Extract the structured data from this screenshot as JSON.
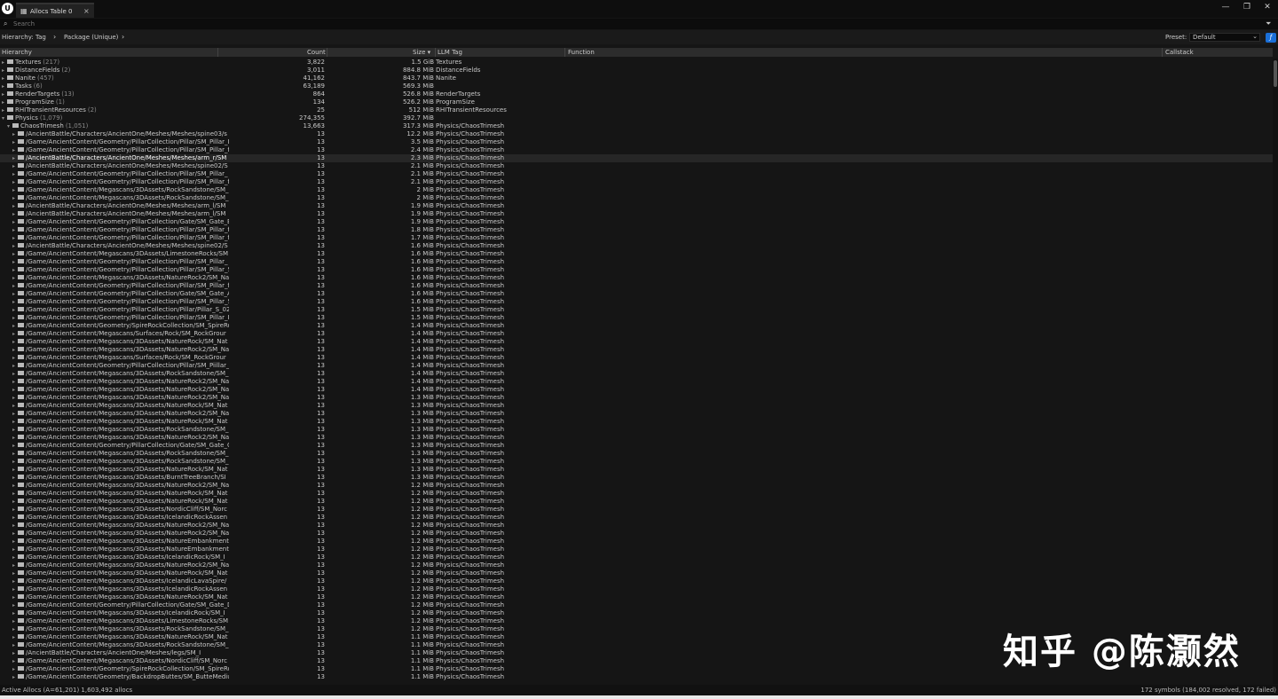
{
  "window": {
    "tab_label": "Allocs Table 0",
    "tab_close": "×",
    "minimize": "—",
    "restore": "❐",
    "close": "✕",
    "logo": "U"
  },
  "search": {
    "placeholder": "Search"
  },
  "hierarchy_bar": {
    "label": "Hierarchy:",
    "items": [
      "Tag",
      "Package (Unique)"
    ],
    "preset_label": "Preset:",
    "preset_value": "Default",
    "function_button": "ƒ"
  },
  "columns": {
    "hierarchy": "Hierarchy",
    "count": "Count",
    "size": "Size ▾",
    "llm_tag": "LLM Tag",
    "function": "Function",
    "callstack": "Callstack"
  },
  "icons": {
    "search": "search-icon",
    "filter": "filter-icon",
    "folder": "folder-icon",
    "expand": "expand-arrow-icon"
  },
  "rows": [
    {
      "level": 0,
      "open": false,
      "name": "Textures",
      "cnt": "(217)",
      "count": "3,822",
      "size": "1.5 GiB",
      "tag": "Textures"
    },
    {
      "level": 0,
      "open": false,
      "name": "DistanceFields",
      "cnt": "(2)",
      "count": "3,011",
      "size": "884.8 MiB",
      "tag": "DistanceFields"
    },
    {
      "level": 0,
      "open": false,
      "name": "Nanite",
      "cnt": "(457)",
      "count": "41,162",
      "size": "843.7 MiB",
      "tag": "Nanite"
    },
    {
      "level": 0,
      "open": false,
      "name": "Tasks",
      "cnt": "(6)",
      "count": "63,189",
      "size": "569.3 MiB",
      "tag": ""
    },
    {
      "level": 0,
      "open": false,
      "name": "RenderTargets",
      "cnt": "(13)",
      "count": "864",
      "size": "526.8 MiB",
      "tag": "RenderTargets"
    },
    {
      "level": 0,
      "open": false,
      "name": "ProgramSize",
      "cnt": "(1)",
      "count": "134",
      "size": "526.2 MiB",
      "tag": "ProgramSize"
    },
    {
      "level": 0,
      "open": false,
      "name": "RHITransientResources",
      "cnt": "(2)",
      "count": "25",
      "size": "512 MiB",
      "tag": "RHITransientResources"
    },
    {
      "level": 0,
      "open": true,
      "name": "Physics",
      "cnt": "(1,079)",
      "count": "274,355",
      "size": "392.7 MiB",
      "tag": ""
    },
    {
      "level": 1,
      "open": true,
      "name": "ChaosTrimesh",
      "cnt": "(1,051)",
      "count": "13,663",
      "size": "317.3 MiB",
      "tag": "Physics/ChaosTrimesh"
    },
    {
      "level": 2,
      "name": "/AncientBattle/Characters/AncientOne/Meshes/Meshes/spine03/s",
      "count": "13",
      "size": "12.2 MiB",
      "tag": "Physics/ChaosTrimesh"
    },
    {
      "level": 2,
      "name": "/Game/AncientContent/Geometry/PillarCollection/Pillar/SM_Pillar_I",
      "count": "13",
      "size": "3.5 MiB",
      "tag": "Physics/ChaosTrimesh"
    },
    {
      "level": 2,
      "name": "/Game/AncientContent/Geometry/PillarCollection/Pillar/SM_Pillar_f",
      "count": "13",
      "size": "2.4 MiB",
      "tag": "Physics/ChaosTrimesh"
    },
    {
      "level": 2,
      "name": "/AncientBattle/Characters/AncientOne/Meshes/Meshes/arm_r/SM",
      "count": "13",
      "size": "2.3 MiB",
      "tag": "Physics/ChaosTrimesh",
      "selected": true
    },
    {
      "level": 2,
      "name": "/AncientBattle/Characters/AncientOne/Meshes/Meshes/spine02/S",
      "count": "13",
      "size": "2.1 MiB",
      "tag": "Physics/ChaosTrimesh"
    },
    {
      "level": 2,
      "name": "/Game/AncientContent/Geometry/PillarCollection/Pillar/SM_Pillar_",
      "count": "13",
      "size": "2.1 MiB",
      "tag": "Physics/ChaosTrimesh"
    },
    {
      "level": 2,
      "name": "/Game/AncientContent/Geometry/PillarCollection/Pillar/SM_Pillar_f",
      "count": "13",
      "size": "2.1 MiB",
      "tag": "Physics/ChaosTrimesh"
    },
    {
      "level": 2,
      "name": "/Game/AncientContent/Megascans/3DAssets/RockSandstone/SM_",
      "count": "13",
      "size": "2 MiB",
      "tag": "Physics/ChaosTrimesh"
    },
    {
      "level": 2,
      "name": "/Game/AncientContent/Megascans/3DAssets/RockSandstone/SM_",
      "count": "13",
      "size": "2 MiB",
      "tag": "Physics/ChaosTrimesh"
    },
    {
      "level": 2,
      "name": "/AncientBattle/Characters/AncientOne/Meshes/Meshes/arm_l/SM",
      "count": "13",
      "size": "1.9 MiB",
      "tag": "Physics/ChaosTrimesh"
    },
    {
      "level": 2,
      "name": "/AncientBattle/Characters/AncientOne/Meshes/Meshes/arm_l/SM",
      "count": "13",
      "size": "1.9 MiB",
      "tag": "Physics/ChaosTrimesh"
    },
    {
      "level": 2,
      "name": "/Game/AncientContent/Geometry/PillarCollection/Gate/SM_Gate_B",
      "count": "13",
      "size": "1.9 MiB",
      "tag": "Physics/ChaosTrimesh"
    },
    {
      "level": 2,
      "name": "/Game/AncientContent/Geometry/PillarCollection/Pillar/SM_Pillar_f",
      "count": "13",
      "size": "1.8 MiB",
      "tag": "Physics/ChaosTrimesh"
    },
    {
      "level": 2,
      "name": "/Game/AncientContent/Geometry/PillarCollection/Pillar/SM_Pillar_f",
      "count": "13",
      "size": "1.7 MiB",
      "tag": "Physics/ChaosTrimesh"
    },
    {
      "level": 2,
      "name": "/AncientBattle/Characters/AncientOne/Meshes/Meshes/spine02/S",
      "count": "13",
      "size": "1.6 MiB",
      "tag": "Physics/ChaosTrimesh"
    },
    {
      "level": 2,
      "name": "/Game/AncientContent/Megascans/3DAssets/LimestoneRocks/SM",
      "count": "13",
      "size": "1.6 MiB",
      "tag": "Physics/ChaosTrimesh"
    },
    {
      "level": 2,
      "name": "/Game/AncientContent/Geometry/PillarCollection/Pillar/SM_Pillar_",
      "count": "13",
      "size": "1.6 MiB",
      "tag": "Physics/ChaosTrimesh"
    },
    {
      "level": 2,
      "name": "/Game/AncientContent/Geometry/PillarCollection/Pillar/SM_Pillar_S",
      "count": "13",
      "size": "1.6 MiB",
      "tag": "Physics/ChaosTrimesh"
    },
    {
      "level": 2,
      "name": "/Game/AncientContent/Megascans/3DAssets/NatureRock2/SM_Na",
      "count": "13",
      "size": "1.6 MiB",
      "tag": "Physics/ChaosTrimesh"
    },
    {
      "level": 2,
      "name": "/Game/AncientContent/Geometry/PillarCollection/Pillar/SM_Pillar_f",
      "count": "13",
      "size": "1.6 MiB",
      "tag": "Physics/ChaosTrimesh"
    },
    {
      "level": 2,
      "name": "/Game/AncientContent/Geometry/PillarCollection/Gate/SM_Gate_A",
      "count": "13",
      "size": "1.6 MiB",
      "tag": "Physics/ChaosTrimesh"
    },
    {
      "level": 2,
      "name": "/Game/AncientContent/Geometry/PillarCollection/Pillar/SM_Pillar_S",
      "count": "13",
      "size": "1.6 MiB",
      "tag": "Physics/ChaosTrimesh"
    },
    {
      "level": 2,
      "name": "/Game/AncientContent/Geometry/PillarCollection/Pillar/Pillar_S_02",
      "count": "13",
      "size": "1.5 MiB",
      "tag": "Physics/ChaosTrimesh"
    },
    {
      "level": 2,
      "name": "/Game/AncientContent/Geometry/PillarCollection/Pillar/SM_Pillar_I",
      "count": "13",
      "size": "1.5 MiB",
      "tag": "Physics/ChaosTrimesh"
    },
    {
      "level": 2,
      "name": "/Game/AncientContent/Geometry/SpireRockCollection/SM_SpireRo",
      "count": "13",
      "size": "1.4 MiB",
      "tag": "Physics/ChaosTrimesh"
    },
    {
      "level": 2,
      "name": "/Game/AncientContent/Megascans/Surfaces/Rock/SM_RockGrour",
      "count": "13",
      "size": "1.4 MiB",
      "tag": "Physics/ChaosTrimesh"
    },
    {
      "level": 2,
      "name": "/Game/AncientContent/Megascans/3DAssets/NatureRock/SM_Nat",
      "count": "13",
      "size": "1.4 MiB",
      "tag": "Physics/ChaosTrimesh"
    },
    {
      "level": 2,
      "name": "/Game/AncientContent/Megascans/3DAssets/NatureRock2/SM_Na",
      "count": "13",
      "size": "1.4 MiB",
      "tag": "Physics/ChaosTrimesh"
    },
    {
      "level": 2,
      "name": "/Game/AncientContent/Megascans/Surfaces/Rock/SM_RockGrour",
      "count": "13",
      "size": "1.4 MiB",
      "tag": "Physics/ChaosTrimesh"
    },
    {
      "level": 2,
      "name": "/Game/AncientContent/Geometry/PillarCollection/Pillar/SM_Piillar_",
      "count": "13",
      "size": "1.4 MiB",
      "tag": "Physics/ChaosTrimesh"
    },
    {
      "level": 2,
      "name": "/Game/AncientContent/Megascans/3DAssets/RockSandstone/SM_",
      "count": "13",
      "size": "1.4 MiB",
      "tag": "Physics/ChaosTrimesh"
    },
    {
      "level": 2,
      "name": "/Game/AncientContent/Megascans/3DAssets/NatureRock2/SM_Na",
      "count": "13",
      "size": "1.4 MiB",
      "tag": "Physics/ChaosTrimesh"
    },
    {
      "level": 2,
      "name": "/Game/AncientContent/Megascans/3DAssets/NatureRock2/SM_Na",
      "count": "13",
      "size": "1.4 MiB",
      "tag": "Physics/ChaosTrimesh"
    },
    {
      "level": 2,
      "name": "/Game/AncientContent/Megascans/3DAssets/NatureRock2/SM_Na",
      "count": "13",
      "size": "1.3 MiB",
      "tag": "Physics/ChaosTrimesh"
    },
    {
      "level": 2,
      "name": "/Game/AncientContent/Megascans/3DAssets/NatureRock/SM_Nat",
      "count": "13",
      "size": "1.3 MiB",
      "tag": "Physics/ChaosTrimesh"
    },
    {
      "level": 2,
      "name": "/Game/AncientContent/Megascans/3DAssets/NatureRock2/SM_Na",
      "count": "13",
      "size": "1.3 MiB",
      "tag": "Physics/ChaosTrimesh"
    },
    {
      "level": 2,
      "name": "/Game/AncientContent/Megascans/3DAssets/NatureRock/SM_Nat",
      "count": "13",
      "size": "1.3 MiB",
      "tag": "Physics/ChaosTrimesh"
    },
    {
      "level": 2,
      "name": "/Game/AncientContent/Megascans/3DAssets/RockSandstone/SM_",
      "count": "13",
      "size": "1.3 MiB",
      "tag": "Physics/ChaosTrimesh"
    },
    {
      "level": 2,
      "name": "/Game/AncientContent/Megascans/3DAssets/NatureRock2/SM_Na",
      "count": "13",
      "size": "1.3 MiB",
      "tag": "Physics/ChaosTrimesh"
    },
    {
      "level": 2,
      "name": "/Game/AncientContent/Geometry/PillarCollection/Gate/SM_Gate_C",
      "count": "13",
      "size": "1.3 MiB",
      "tag": "Physics/ChaosTrimesh"
    },
    {
      "level": 2,
      "name": "/Game/AncientContent/Megascans/3DAssets/RockSandstone/SM_",
      "count": "13",
      "size": "1.3 MiB",
      "tag": "Physics/ChaosTrimesh"
    },
    {
      "level": 2,
      "name": "/Game/AncientContent/Megascans/3DAssets/RockSandstone/SM_",
      "count": "13",
      "size": "1.3 MiB",
      "tag": "Physics/ChaosTrimesh"
    },
    {
      "level": 2,
      "name": "/Game/AncientContent/Megascans/3DAssets/NatureRock/SM_Nat",
      "count": "13",
      "size": "1.3 MiB",
      "tag": "Physics/ChaosTrimesh"
    },
    {
      "level": 2,
      "name": "/Game/AncientContent/Megascans/3DAssets/BurntTreeBranch/SI",
      "count": "13",
      "size": "1.3 MiB",
      "tag": "Physics/ChaosTrimesh"
    },
    {
      "level": 2,
      "name": "/Game/AncientContent/Megascans/3DAssets/NatureRock2/SM_Na",
      "count": "13",
      "size": "1.2 MiB",
      "tag": "Physics/ChaosTrimesh"
    },
    {
      "level": 2,
      "name": "/Game/AncientContent/Megascans/3DAssets/NatureRock/SM_Nat",
      "count": "13",
      "size": "1.2 MiB",
      "tag": "Physics/ChaosTrimesh"
    },
    {
      "level": 2,
      "name": "/Game/AncientContent/Megascans/3DAssets/NatureRock/SM_Nat",
      "count": "13",
      "size": "1.2 MiB",
      "tag": "Physics/ChaosTrimesh"
    },
    {
      "level": 2,
      "name": "/Game/AncientContent/Megascans/3DAssets/NordicCliff/SM_Norc",
      "count": "13",
      "size": "1.2 MiB",
      "tag": "Physics/ChaosTrimesh"
    },
    {
      "level": 2,
      "name": "/Game/AncientContent/Megascans/3DAssets/IcelandicRockAssen",
      "count": "13",
      "size": "1.2 MiB",
      "tag": "Physics/ChaosTrimesh"
    },
    {
      "level": 2,
      "name": "/Game/AncientContent/Megascans/3DAssets/NatureRock2/SM_Na",
      "count": "13",
      "size": "1.2 MiB",
      "tag": "Physics/ChaosTrimesh"
    },
    {
      "level": 2,
      "name": "/Game/AncientContent/Megascans/3DAssets/NatureRock2/SM_Na",
      "count": "13",
      "size": "1.2 MiB",
      "tag": "Physics/ChaosTrimesh"
    },
    {
      "level": 2,
      "name": "/Game/AncientContent/Megascans/3DAssets/NatureEmbankment",
      "count": "13",
      "size": "1.2 MiB",
      "tag": "Physics/ChaosTrimesh"
    },
    {
      "level": 2,
      "name": "/Game/AncientContent/Megascans/3DAssets/NatureEmbankment",
      "count": "13",
      "size": "1.2 MiB",
      "tag": "Physics/ChaosTrimesh"
    },
    {
      "level": 2,
      "name": "/Game/AncientContent/Megascans/3DAssets/IcelandicRock/SM_I",
      "count": "13",
      "size": "1.2 MiB",
      "tag": "Physics/ChaosTrimesh"
    },
    {
      "level": 2,
      "name": "/Game/AncientContent/Megascans/3DAssets/NatureRock2/SM_Na",
      "count": "13",
      "size": "1.2 MiB",
      "tag": "Physics/ChaosTrimesh"
    },
    {
      "level": 2,
      "name": "/Game/AncientContent/Megascans/3DAssets/NatureRock/SM_Nat",
      "count": "13",
      "size": "1.2 MiB",
      "tag": "Physics/ChaosTrimesh"
    },
    {
      "level": 2,
      "name": "/Game/AncientContent/Megascans/3DAssets/IcelandicLavaSpire/",
      "count": "13",
      "size": "1.2 MiB",
      "tag": "Physics/ChaosTrimesh"
    },
    {
      "level": 2,
      "name": "/Game/AncientContent/Megascans/3DAssets/IcelandicRockAssen",
      "count": "13",
      "size": "1.2 MiB",
      "tag": "Physics/ChaosTrimesh"
    },
    {
      "level": 2,
      "name": "/Game/AncientContent/Megascans/3DAssets/NatureRock/SM_Nat",
      "count": "13",
      "size": "1.2 MiB",
      "tag": "Physics/ChaosTrimesh"
    },
    {
      "level": 2,
      "name": "/Game/AncientContent/Geometry/PillarCollection/Gate/SM_Gate_D",
      "count": "13",
      "size": "1.2 MiB",
      "tag": "Physics/ChaosTrimesh"
    },
    {
      "level": 2,
      "name": "/Game/AncientContent/Megascans/3DAssets/IcelandicRock/SM_I",
      "count": "13",
      "size": "1.2 MiB",
      "tag": "Physics/ChaosTrimesh"
    },
    {
      "level": 2,
      "name": "/Game/AncientContent/Megascans/3DAssets/LimestoneRocks/SM",
      "count": "13",
      "size": "1.2 MiB",
      "tag": "Physics/ChaosTrimesh"
    },
    {
      "level": 2,
      "name": "/Game/AncientContent/Megascans/3DAssets/RockSandstone/SM_",
      "count": "13",
      "size": "1.2 MiB",
      "tag": "Physics/ChaosTrimesh"
    },
    {
      "level": 2,
      "name": "/Game/AncientContent/Megascans/3DAssets/NatureRock/SM_Nat",
      "count": "13",
      "size": "1.1 MiB",
      "tag": "Physics/ChaosTrimesh"
    },
    {
      "level": 2,
      "name": "/Game/AncientContent/Megascans/3DAssets/RockSandstone/SM_",
      "count": "13",
      "size": "1.1 MiB",
      "tag": "Physics/ChaosTrimesh"
    },
    {
      "level": 2,
      "name": "/AncientBattle/Characters/AncientOne/Meshes/legs/SM_I",
      "count": "13",
      "size": "1.1 MiB",
      "tag": "Physics/ChaosTrimesh"
    },
    {
      "level": 2,
      "name": "/Game/AncientContent/Megascans/3DAssets/NordicCliff/SM_Norc",
      "count": "13",
      "size": "1.1 MiB",
      "tag": "Physics/ChaosTrimesh"
    },
    {
      "level": 2,
      "name": "/Game/AncientContent/Geometry/SpireRockCollection/SM_SpireRo",
      "count": "13",
      "size": "1.1 MiB",
      "tag": "Physics/ChaosTrimesh"
    },
    {
      "level": 2,
      "name": "/Game/AncientContent/Geometry/BackdropButtes/SM_ButteMediu",
      "count": "13",
      "size": "1.1 MiB",
      "tag": "Physics/ChaosTrimesh"
    }
  ],
  "status": {
    "left": "Active Allocs (A=61,201)   1,603,492 allocs",
    "right": "172 symbols (184,002 resolved, 172 failed)"
  },
  "watermark": "知乎 @陈灏然"
}
